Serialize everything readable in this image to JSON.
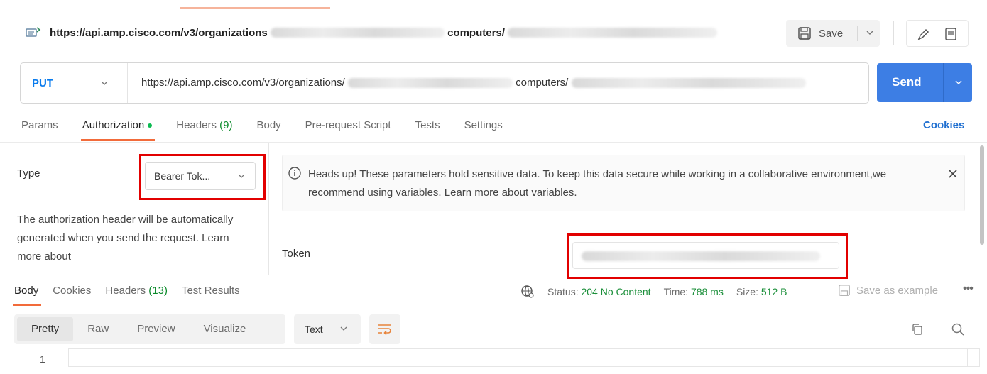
{
  "title_bar": {
    "url_part_1": "https://api.amp.cisco.com/v3/organizations",
    "url_part_2": "computers/",
    "save_label": "Save"
  },
  "request": {
    "method": "PUT",
    "url_part_1": "https://api.amp.cisco.com/v3/organizations/",
    "url_part_2": "computers/",
    "send_label": "Send"
  },
  "tabs": [
    {
      "label": "Params"
    },
    {
      "label": "Authorization",
      "active": true
    },
    {
      "label": "Headers",
      "count": "(9)"
    },
    {
      "label": "Body"
    },
    {
      "label": "Pre-request Script"
    },
    {
      "label": "Tests"
    },
    {
      "label": "Settings"
    }
  ],
  "cookies_link": "Cookies",
  "auth": {
    "type_label": "Type",
    "type_value": "Bearer Tok...",
    "help_text": "The authorization header will be automatically generated when you send the request. Learn more about",
    "notice_text": "Heads up! These parameters hold sensitive data. To keep this data secure while working in a collaborative environment,we recommend using variables. Learn more about",
    "notice_link": "variables",
    "notice_end": ".",
    "token_label": "Token"
  },
  "response": {
    "tabs": [
      {
        "label": "Body",
        "active": true
      },
      {
        "label": "Cookies"
      },
      {
        "label": "Headers",
        "count": "(13)"
      },
      {
        "label": "Test Results"
      }
    ],
    "status_label": "Status:",
    "status_value": "204 No Content",
    "time_label": "Time:",
    "time_value": "788 ms",
    "size_label": "Size:",
    "size_value": "512 B",
    "save_example": "Save as example",
    "more": "•••",
    "view_options": [
      "Pretty",
      "Raw",
      "Preview",
      "Visualize"
    ],
    "format": "Text",
    "line_number": "1"
  },
  "colors": {
    "accent": "#f26b3a",
    "send": "#3d7ee4",
    "method": "#097bed",
    "highlight": "#e20000",
    "status_ok": "#1b8f3a"
  },
  "icons": [
    "request-icon",
    "save-icon",
    "chevron-down-icon",
    "pencil-icon",
    "document-icon",
    "info-icon",
    "close-icon",
    "globe-icon",
    "copy-icon",
    "search-icon",
    "wrap-lines-icon"
  ]
}
